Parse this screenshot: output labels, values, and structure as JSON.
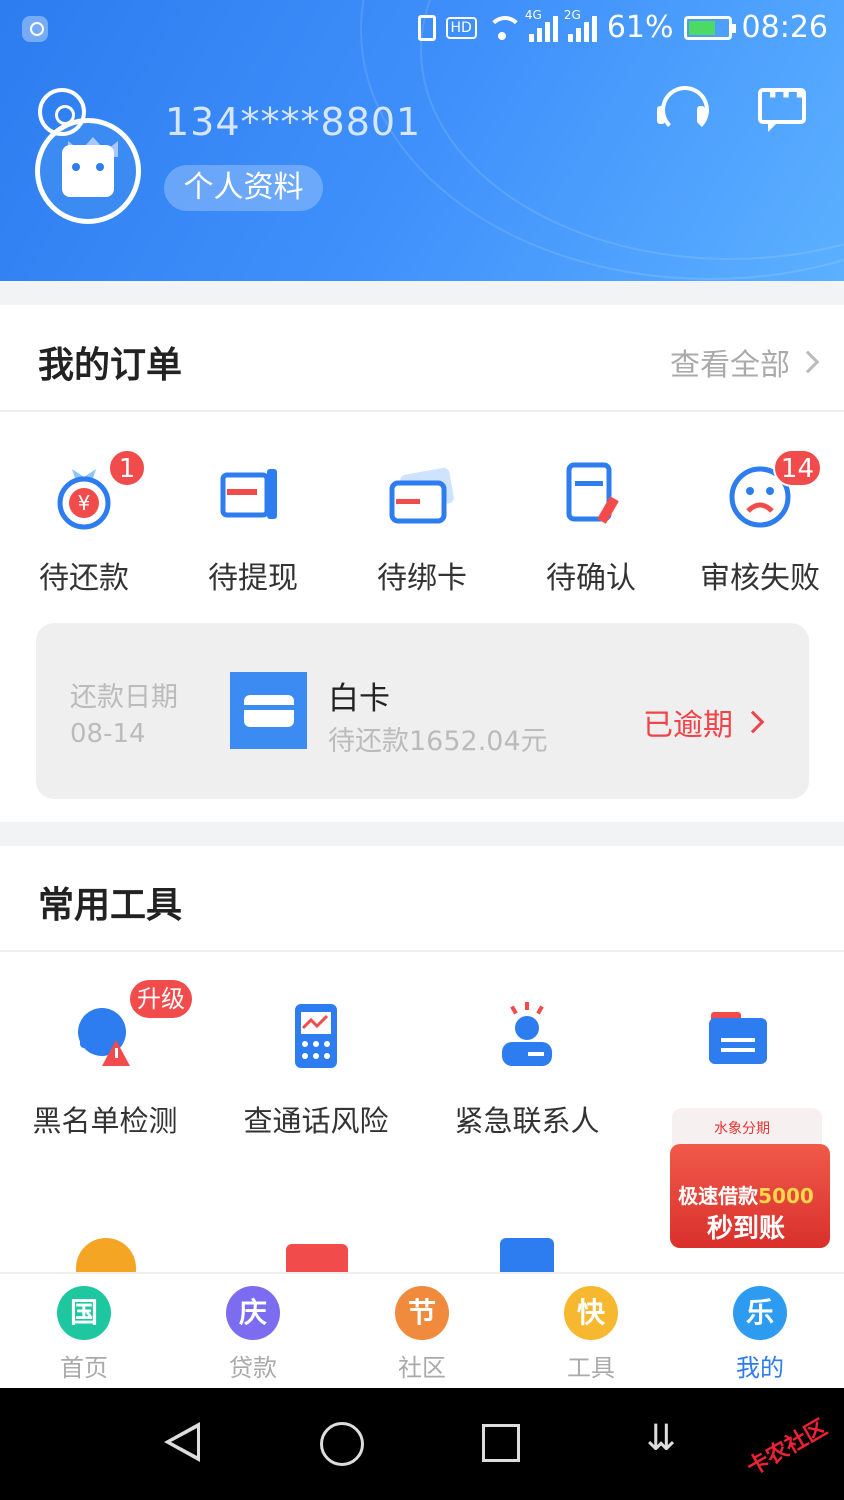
{
  "status_bar": {
    "network_4g": "4G",
    "network_2g": "2G",
    "hd": "HD",
    "battery": "61%",
    "time": "08:26"
  },
  "profile": {
    "phone": "134****8801",
    "profile_button": "个人资料"
  },
  "orders": {
    "title": "我的订单",
    "view_all": "查看全部",
    "items": [
      {
        "label": "待还款",
        "badge": "1",
        "icon": "money-bag-icon"
      },
      {
        "label": "待提现",
        "badge": "",
        "icon": "withdraw-icon"
      },
      {
        "label": "待绑卡",
        "badge": "",
        "icon": "bind-card-icon"
      },
      {
        "label": "待确认",
        "badge": "",
        "icon": "confirm-doc-icon"
      },
      {
        "label": "审核失败",
        "badge": "14",
        "icon": "sad-face-icon"
      }
    ],
    "repayment": {
      "date_label": "还款日期",
      "date_value": "08-14",
      "product_name": "白卡",
      "amount_text": "待还款1652.04元",
      "status": "已逾期"
    }
  },
  "tools": {
    "title": "常用工具",
    "upgrade_badge": "升级",
    "items": [
      {
        "label": "黑名单检测",
        "icon": "blacklist-check-icon"
      },
      {
        "label": "查通话风险",
        "icon": "call-risk-icon"
      },
      {
        "label": "紧急联系人",
        "icon": "emergency-contact-icon"
      }
    ]
  },
  "promo": {
    "brand": "水象分期",
    "line1_prefix": "极速借款",
    "line1_amount": "5000",
    "line2": "秒到账"
  },
  "tabbar": [
    {
      "icon_text": "国",
      "label": "首页",
      "color": "#1fc7a0"
    },
    {
      "icon_text": "庆",
      "label": "贷款",
      "color": "#7b6cf0"
    },
    {
      "icon_text": "节",
      "label": "社区",
      "color": "#f08a3c"
    },
    {
      "icon_text": "快",
      "label": "工具",
      "color": "#f5b82e"
    },
    {
      "icon_text": "乐",
      "label": "我的",
      "color": "#2d9cf0"
    }
  ],
  "watermark": "卡农社区",
  "colors": {
    "brand": "#2d7cf0",
    "alert": "#f24b4b",
    "overdue": "#f0444a"
  }
}
